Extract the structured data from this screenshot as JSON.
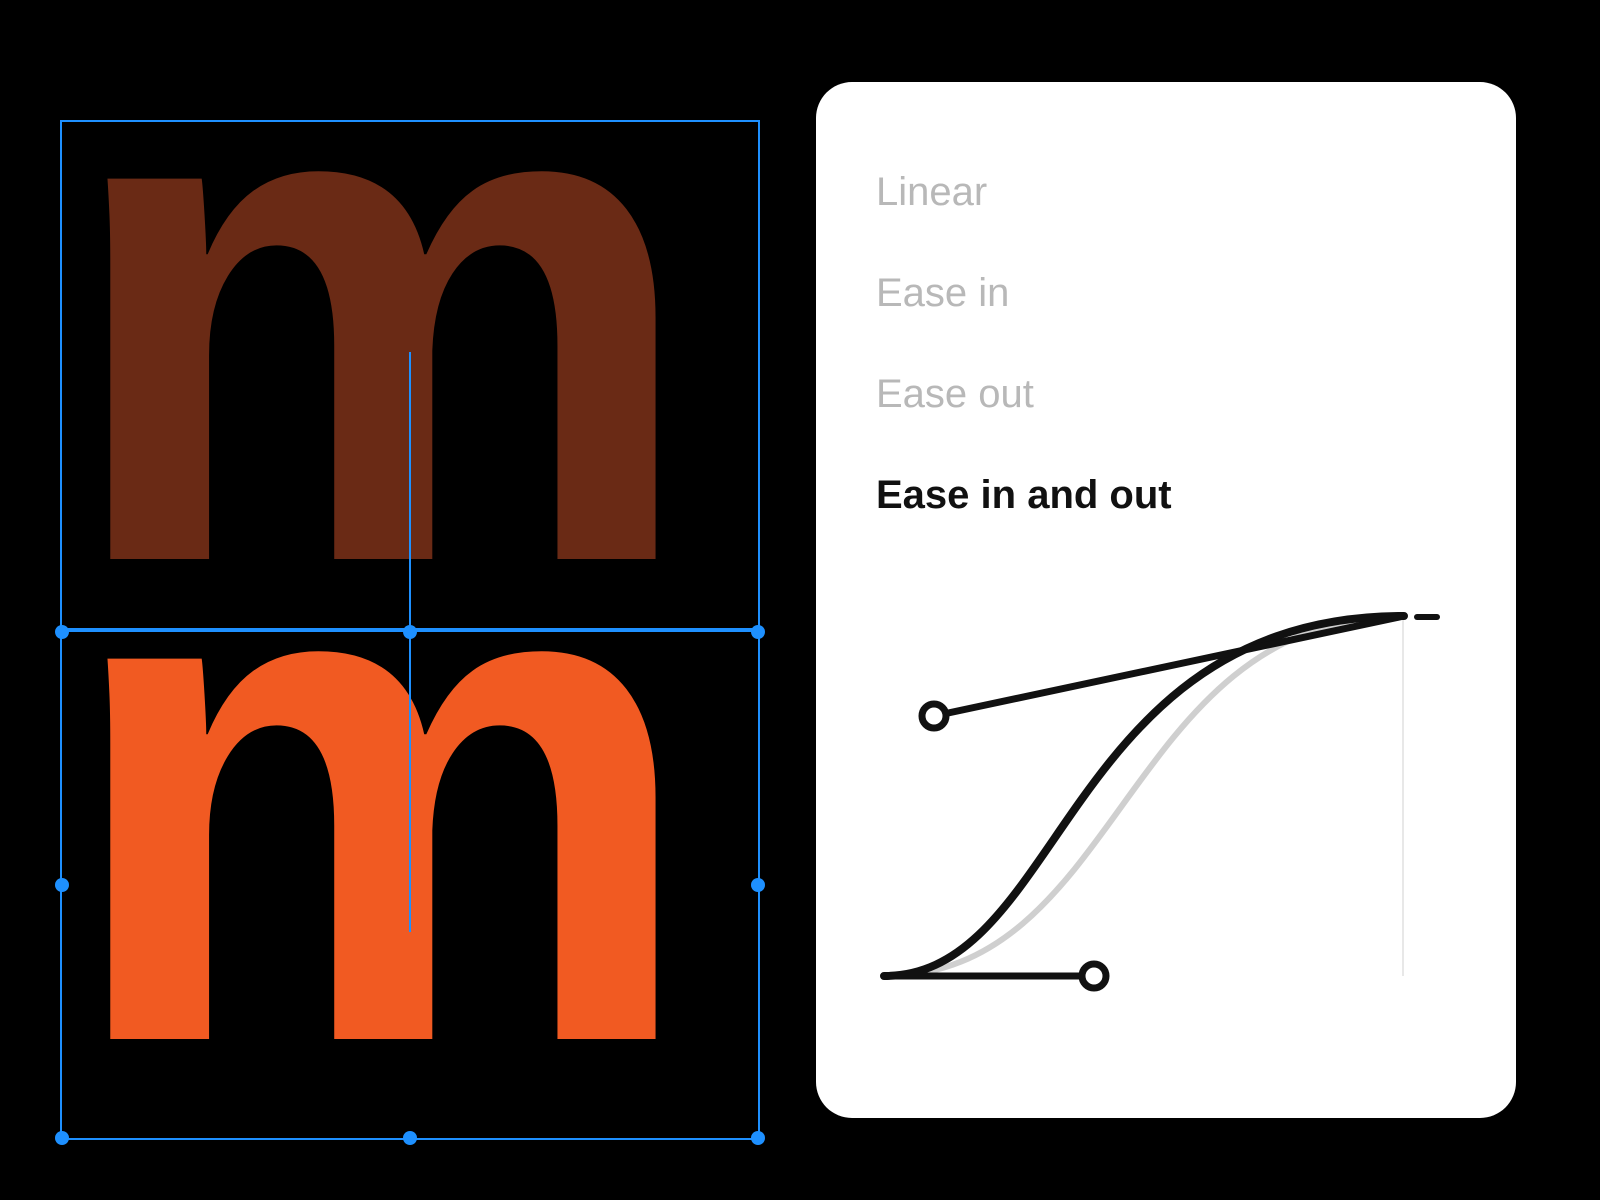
{
  "canvas": {
    "glyph": "m",
    "back_color": "#6a2a15",
    "front_color": "#f15a22",
    "selection_color": "#1e90ff"
  },
  "easing": {
    "options": [
      {
        "label": "Linear",
        "selected": false
      },
      {
        "label": "Ease in",
        "selected": false
      },
      {
        "label": "Ease out",
        "selected": false
      },
      {
        "label": "Ease in and out",
        "selected": true
      }
    ]
  }
}
